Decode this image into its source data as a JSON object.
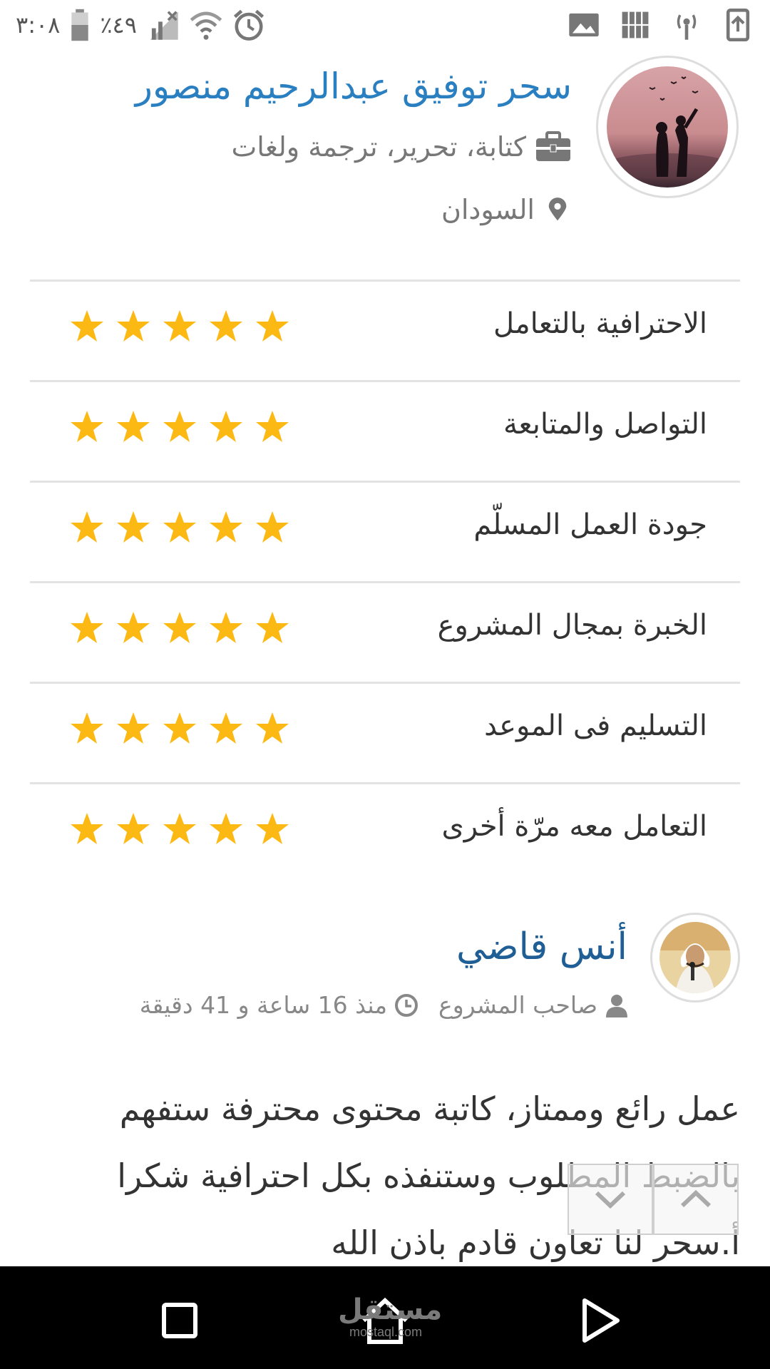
{
  "status_bar": {
    "time": "٣:٠٨",
    "battery": "٪٤٩",
    "icons": [
      "battery-icon",
      "no-signal-icon",
      "wifi-icon",
      "alarm-icon",
      "gallery-icon",
      "sim-icon",
      "hotspot-icon",
      "upload-icon"
    ]
  },
  "freelancer": {
    "name": "سحر توفيق عبدالرحيم منصور",
    "skills": "كتابة، تحرير، ترجمة ولغات",
    "location": "السودان"
  },
  "ratings": [
    {
      "label": "الاحترافية بالتعامل",
      "stars": 5
    },
    {
      "label": "التواصل والمتابعة",
      "stars": 5
    },
    {
      "label": "جودة العمل المسلّم",
      "stars": 5
    },
    {
      "label": "الخبرة بمجال المشروع",
      "stars": 5
    },
    {
      "label": "التسليم فى الموعد",
      "stars": 5
    },
    {
      "label": "التعامل معه مرّة أخرى",
      "stars": 5
    }
  ],
  "review": {
    "reviewer_name": "أنس قاضي",
    "role": "صاحب المشروع",
    "time_ago": "منذ 16 ساعة و 41 دقيقة",
    "text": "عمل رائع وممتاز، كاتبة محتوى محترفة ستفهم بالضبط المطلوب وستنفذه بكل احترافية شكرا أ.سحر لنا تعاون قادم باذن الله"
  },
  "colors": {
    "name_blue": "#2a7fc0",
    "reviewer_blue": "#1f5f95",
    "star_gold": "#fdb913",
    "divider": "#e3e3e3"
  },
  "nav_bar": {
    "watermark_ar": "مستقل",
    "watermark_en": "mostaql.com"
  }
}
